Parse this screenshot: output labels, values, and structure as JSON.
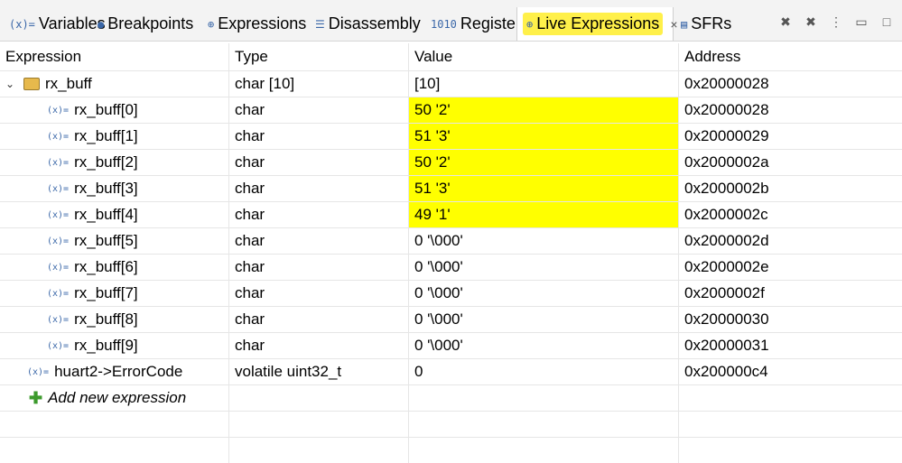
{
  "tabs": [
    {
      "icon": "(x)=",
      "label": "Variables"
    },
    {
      "icon": "●",
      "label": "Breakpoints"
    },
    {
      "icon": "⊕",
      "label": "Expressions"
    },
    {
      "icon": "☰",
      "label": "Disassembly"
    },
    {
      "icon": "1010",
      "label": "Registers"
    },
    {
      "icon": "⊕",
      "label": "Live Expressions",
      "active": true
    },
    {
      "icon": "▤",
      "label": "SFRs"
    }
  ],
  "columns": [
    "Expression",
    "Type",
    "Value",
    "Address"
  ],
  "rows": [
    {
      "expr": "rx_buff",
      "type": "char [10]",
      "value": "[10]",
      "address": "0x20000028"
    },
    {
      "expr": "rx_buff[0]",
      "type": "char",
      "value": "50 '2'",
      "address": "0x20000028"
    },
    {
      "expr": "rx_buff[1]",
      "type": "char",
      "value": "51 '3'",
      "address": "0x20000029"
    },
    {
      "expr": "rx_buff[2]",
      "type": "char",
      "value": "50 '2'",
      "address": "0x2000002a"
    },
    {
      "expr": "rx_buff[3]",
      "type": "char",
      "value": "51 '3'",
      "address": "0x2000002b"
    },
    {
      "expr": "rx_buff[4]",
      "type": "char",
      "value": "49 '1'",
      "address": "0x2000002c"
    },
    {
      "expr": "rx_buff[5]",
      "type": "char",
      "value": "0 '\\000'",
      "address": "0x2000002d"
    },
    {
      "expr": "rx_buff[6]",
      "type": "char",
      "value": "0 '\\000'",
      "address": "0x2000002e"
    },
    {
      "expr": "rx_buff[7]",
      "type": "char",
      "value": "0 '\\000'",
      "address": "0x2000002f"
    },
    {
      "expr": "rx_buff[8]",
      "type": "char",
      "value": "0 '\\000'",
      "address": "0x20000030"
    },
    {
      "expr": "rx_buff[9]",
      "type": "char",
      "value": "0 '\\000'",
      "address": "0x20000031"
    },
    {
      "expr": "huart2->ErrorCode",
      "type": "volatile uint32_t",
      "value": "0",
      "address": "0x200000c4"
    }
  ],
  "add_expression": "Add new expression",
  "icons": {
    "var": "(x)=",
    "struct": "struct-icon",
    "expand": "⌄",
    "add": "✚"
  },
  "colors": {
    "highlight": "#ffff00",
    "tab_highlight": "#fff04a"
  }
}
